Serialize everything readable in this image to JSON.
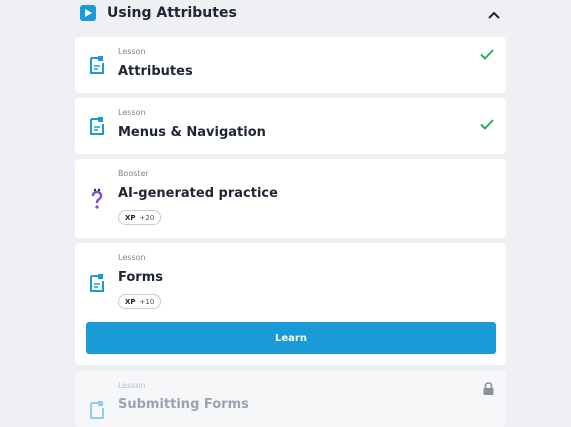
{
  "section": {
    "title": "Using Attributes"
  },
  "items": [
    {
      "type": "Lesson",
      "title": "Attributes",
      "completed": true
    },
    {
      "type": "Lesson",
      "title": "Menus & Navigation",
      "completed": true
    },
    {
      "type": "Booster",
      "title": "AI-generated practice",
      "xp_label": "XP",
      "xp_value": "+20"
    },
    {
      "type": "Lesson",
      "title": "Forms",
      "xp_label": "XP",
      "xp_value": "+10",
      "button": "Learn"
    },
    {
      "type": "Lesson",
      "title": "Submitting Forms",
      "locked": true
    }
  ],
  "colors": {
    "accent": "#1a9bd8",
    "check": "#2eaa5c",
    "booster": "#7a4fd1"
  }
}
